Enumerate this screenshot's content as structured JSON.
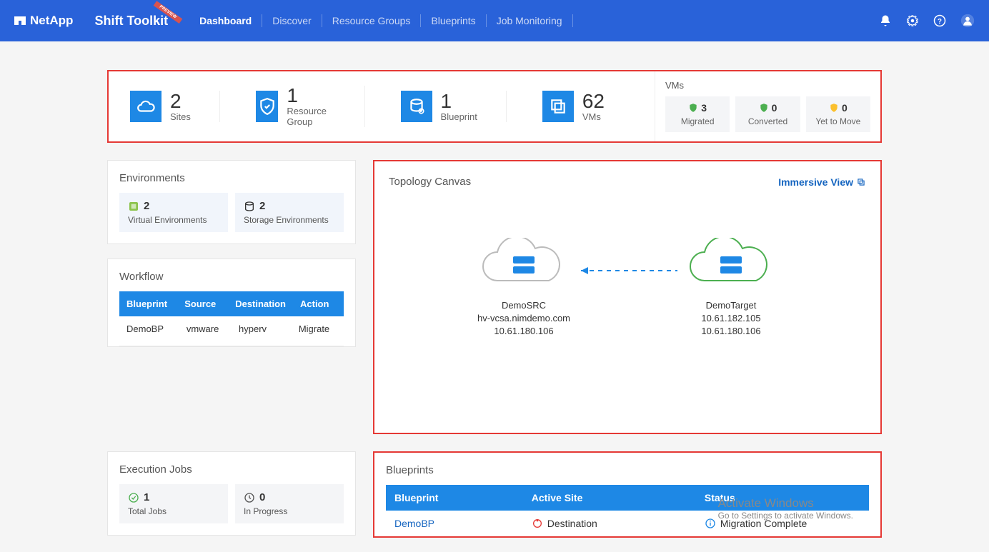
{
  "header": {
    "brand": "NetApp",
    "product": "Shift Toolkit",
    "ribbon": "PREVIEW",
    "nav": [
      "Dashboard",
      "Discover",
      "Resource Groups",
      "Blueprints",
      "Job Monitoring"
    ]
  },
  "kpi": {
    "sites": {
      "value": "2",
      "label": "Sites"
    },
    "rg": {
      "value": "1",
      "label": "Resource Group"
    },
    "blueprint": {
      "value": "1",
      "label": "Blueprint"
    },
    "vms": {
      "value": "62",
      "label": "VMs"
    }
  },
  "vm_box": {
    "title": "VMs",
    "migrated": {
      "value": "3",
      "label": "Migrated"
    },
    "converted": {
      "value": "0",
      "label": "Converted"
    },
    "yet": {
      "value": "0",
      "label": "Yet to Move"
    }
  },
  "env": {
    "title": "Environments",
    "virtual": {
      "value": "2",
      "label": "Virtual Environments"
    },
    "storage": {
      "value": "2",
      "label": "Storage Environments"
    }
  },
  "workflow": {
    "title": "Workflow",
    "headers": {
      "bp": "Blueprint",
      "src": "Source",
      "dst": "Destination",
      "act": "Action"
    },
    "row": {
      "bp": "DemoBP",
      "src": "vmware",
      "dst": "hyperv",
      "act": "Migrate"
    }
  },
  "topology": {
    "title": "Topology Canvas",
    "link": "Immersive View",
    "source": {
      "name": "DemoSRC",
      "line2": "hv-vcsa.nimdemo.com",
      "line3": "10.61.180.106"
    },
    "target": {
      "name": "DemoTarget",
      "line2": "10.61.182.105",
      "line3": "10.61.180.106"
    }
  },
  "exec": {
    "title": "Execution Jobs",
    "total": {
      "value": "1",
      "label": "Total Jobs"
    },
    "inprog": {
      "value": "0",
      "label": "In Progress"
    }
  },
  "blueprints": {
    "title": "Blueprints",
    "headers": {
      "bp": "Blueprint",
      "site": "Active Site",
      "status": "Status"
    },
    "row": {
      "bp": "DemoBP",
      "site": "Destination",
      "status": "Migration Complete"
    }
  },
  "watermark": {
    "title": "Activate Windows",
    "sub": "Go to Settings to activate Windows."
  }
}
